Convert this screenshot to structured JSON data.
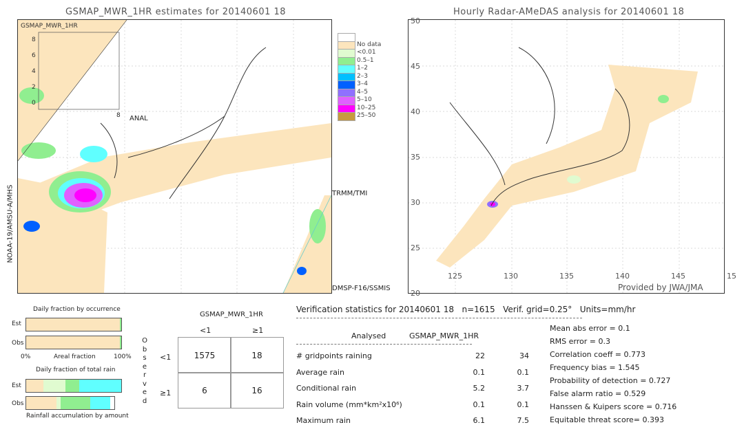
{
  "left_map": {
    "title": "GSMAP_MWR_1HR estimates for 20140601 18",
    "inset_label": "GSMAP_MWR_1HR",
    "inset_ticks": [
      "8",
      "6",
      "4",
      "2",
      "0"
    ],
    "inset_xtick": "8",
    "labels": {
      "anal": "ANAL",
      "trmm": "TRMM/TMI",
      "dmsp": "DMSP-F16/SSMIS",
      "noaa": "NOAA-19/AMSU-A/MHS"
    }
  },
  "right_map": {
    "title": "Hourly Radar-AMeDAS analysis for 20140601 18",
    "lat_ticks": [
      "50",
      "45",
      "40",
      "35",
      "30",
      "25",
      "20"
    ],
    "lon_ticks": [
      "125",
      "130",
      "135",
      "140",
      "145",
      "15"
    ],
    "credit": "Provided by JWA/JMA"
  },
  "legend": [
    {
      "label": "",
      "color": "#ffffff"
    },
    {
      "label": "No data",
      "color": "#fce5bd"
    },
    {
      "label": "<0.01",
      "color": "#e0fbd0"
    },
    {
      "label": "0.5–1",
      "color": "#90ee90"
    },
    {
      "label": "1–2",
      "color": "#60ffff"
    },
    {
      "label": "2–3",
      "color": "#00bfff"
    },
    {
      "label": "3–4",
      "color": "#0060ff"
    },
    {
      "label": "4–5",
      "color": "#9070ff"
    },
    {
      "label": "5–10",
      "color": "#e060ff"
    },
    {
      "label": "10–25",
      "color": "#ff00ff"
    },
    {
      "label": "25–50",
      "color": "#c89a40"
    }
  ],
  "occurrence": {
    "title": "Daily fraction by occurrence",
    "est": "Est",
    "obs": "Obs",
    "x0": "0%",
    "xlabel": "Areal fraction",
    "x1": "100%",
    "est_fraction_nodata": 0.985,
    "obs_fraction_nodata": 0.985
  },
  "total_rain": {
    "title": "Daily fraction of total rain",
    "est": "Est",
    "obs": "Obs",
    "footer": "Rainfall accumulation by amount",
    "est_segments": [
      {
        "color": "#fce5bd",
        "fraction": 0.18
      },
      {
        "color": "#e0fbd0",
        "fraction": 0.23
      },
      {
        "color": "#90ee90",
        "fraction": 0.15
      },
      {
        "color": "#60ffff",
        "fraction": 0.44
      }
    ],
    "obs_segments": [
      {
        "color": "#fce5bd",
        "fraction": 0.34
      },
      {
        "color": "#e0fbd0",
        "fraction": 0.05
      },
      {
        "color": "#90ee90",
        "fraction": 0.34
      },
      {
        "color": "#60ffff",
        "fraction": 0.22
      }
    ]
  },
  "contingency": {
    "title": "GSMAP_MWR_1HR",
    "col_headers": [
      "<1",
      "≥1"
    ],
    "row_label": "Observed",
    "row_headers": [
      "<1",
      "≥1"
    ],
    "cells": [
      [
        "1575",
        "18"
      ],
      [
        "6",
        "16"
      ]
    ]
  },
  "stats": {
    "header": "Verification statistics for 20140601 18   n=1615   Verif. grid=0.25°   Units=mm/hr",
    "col1": "Analysed",
    "col2": "GSMAP_MWR_1HR",
    "rows": [
      {
        "label": "# gridpoints raining",
        "a": "22",
        "g": "34"
      },
      {
        "label": "Average rain",
        "a": "0.1",
        "g": "0.1"
      },
      {
        "label": "Conditional rain",
        "a": "5.2",
        "g": "3.7"
      },
      {
        "label": "Rain volume (mm*km²x10⁶)",
        "a": "0.1",
        "g": "0.1"
      },
      {
        "label": "Maximum rain",
        "a": "6.1",
        "g": "7.5"
      }
    ],
    "scores": [
      "Mean abs error = 0.1",
      "RMS error = 0.3",
      "Correlation coeff = 0.773",
      "Frequency bias = 1.545",
      "Probability of detection = 0.727",
      "False alarm ratio = 0.529",
      "Hanssen & Kuipers score = 0.716",
      "Equitable threat score= 0.393"
    ]
  }
}
